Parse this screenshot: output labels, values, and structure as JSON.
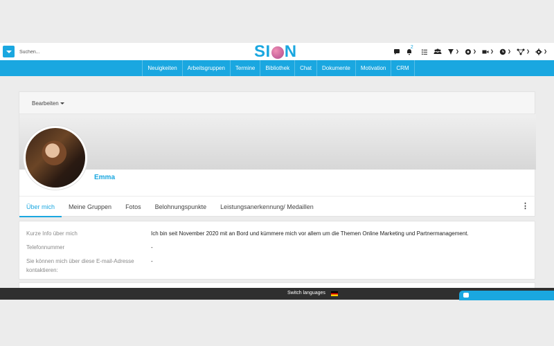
{
  "header": {
    "search_placeholder": "Suchen...",
    "logo_left": "SI",
    "logo_right": "N",
    "notification_count": "2",
    "icons": [
      "chat-icon",
      "bell-icon",
      "checklist-icon",
      "users-icon",
      "gift-icon",
      "megaphone-icon",
      "video-icon",
      "clock-icon",
      "network-icon",
      "gear-icon"
    ]
  },
  "nav": {
    "items": [
      "Neuigkeiten",
      "Arbeitsgruppen",
      "Termine",
      "Bibliothek",
      "Chat",
      "Dokumente",
      "Motivation",
      "CRM"
    ]
  },
  "profile": {
    "edit_label": "Bearbeiten",
    "name": "Emma",
    "tabs": [
      "Über mich",
      "Meine Gruppen",
      "Fotos",
      "Belohnungspunkte",
      "Leistungsanerkennung/ Medaillen"
    ],
    "active_tab": "Über mich"
  },
  "about": {
    "rows": [
      {
        "label": "Kurze Info über mich",
        "value": "Ich bin seit November 2020 mit an Bord und kümmere mich vor allem um die Themen Online Marketing und Partnermanagement."
      },
      {
        "label": "Telefonnummer",
        "value": "-"
      },
      {
        "label": "Sie können mich über diese E-mail-Adresse kontaktieren:",
        "value": "-"
      }
    ]
  },
  "footer": {
    "switch_languages": "Switch languages"
  },
  "colors": {
    "accent": "#1aa7e0",
    "footer_bg": "#2f2f2f"
  }
}
